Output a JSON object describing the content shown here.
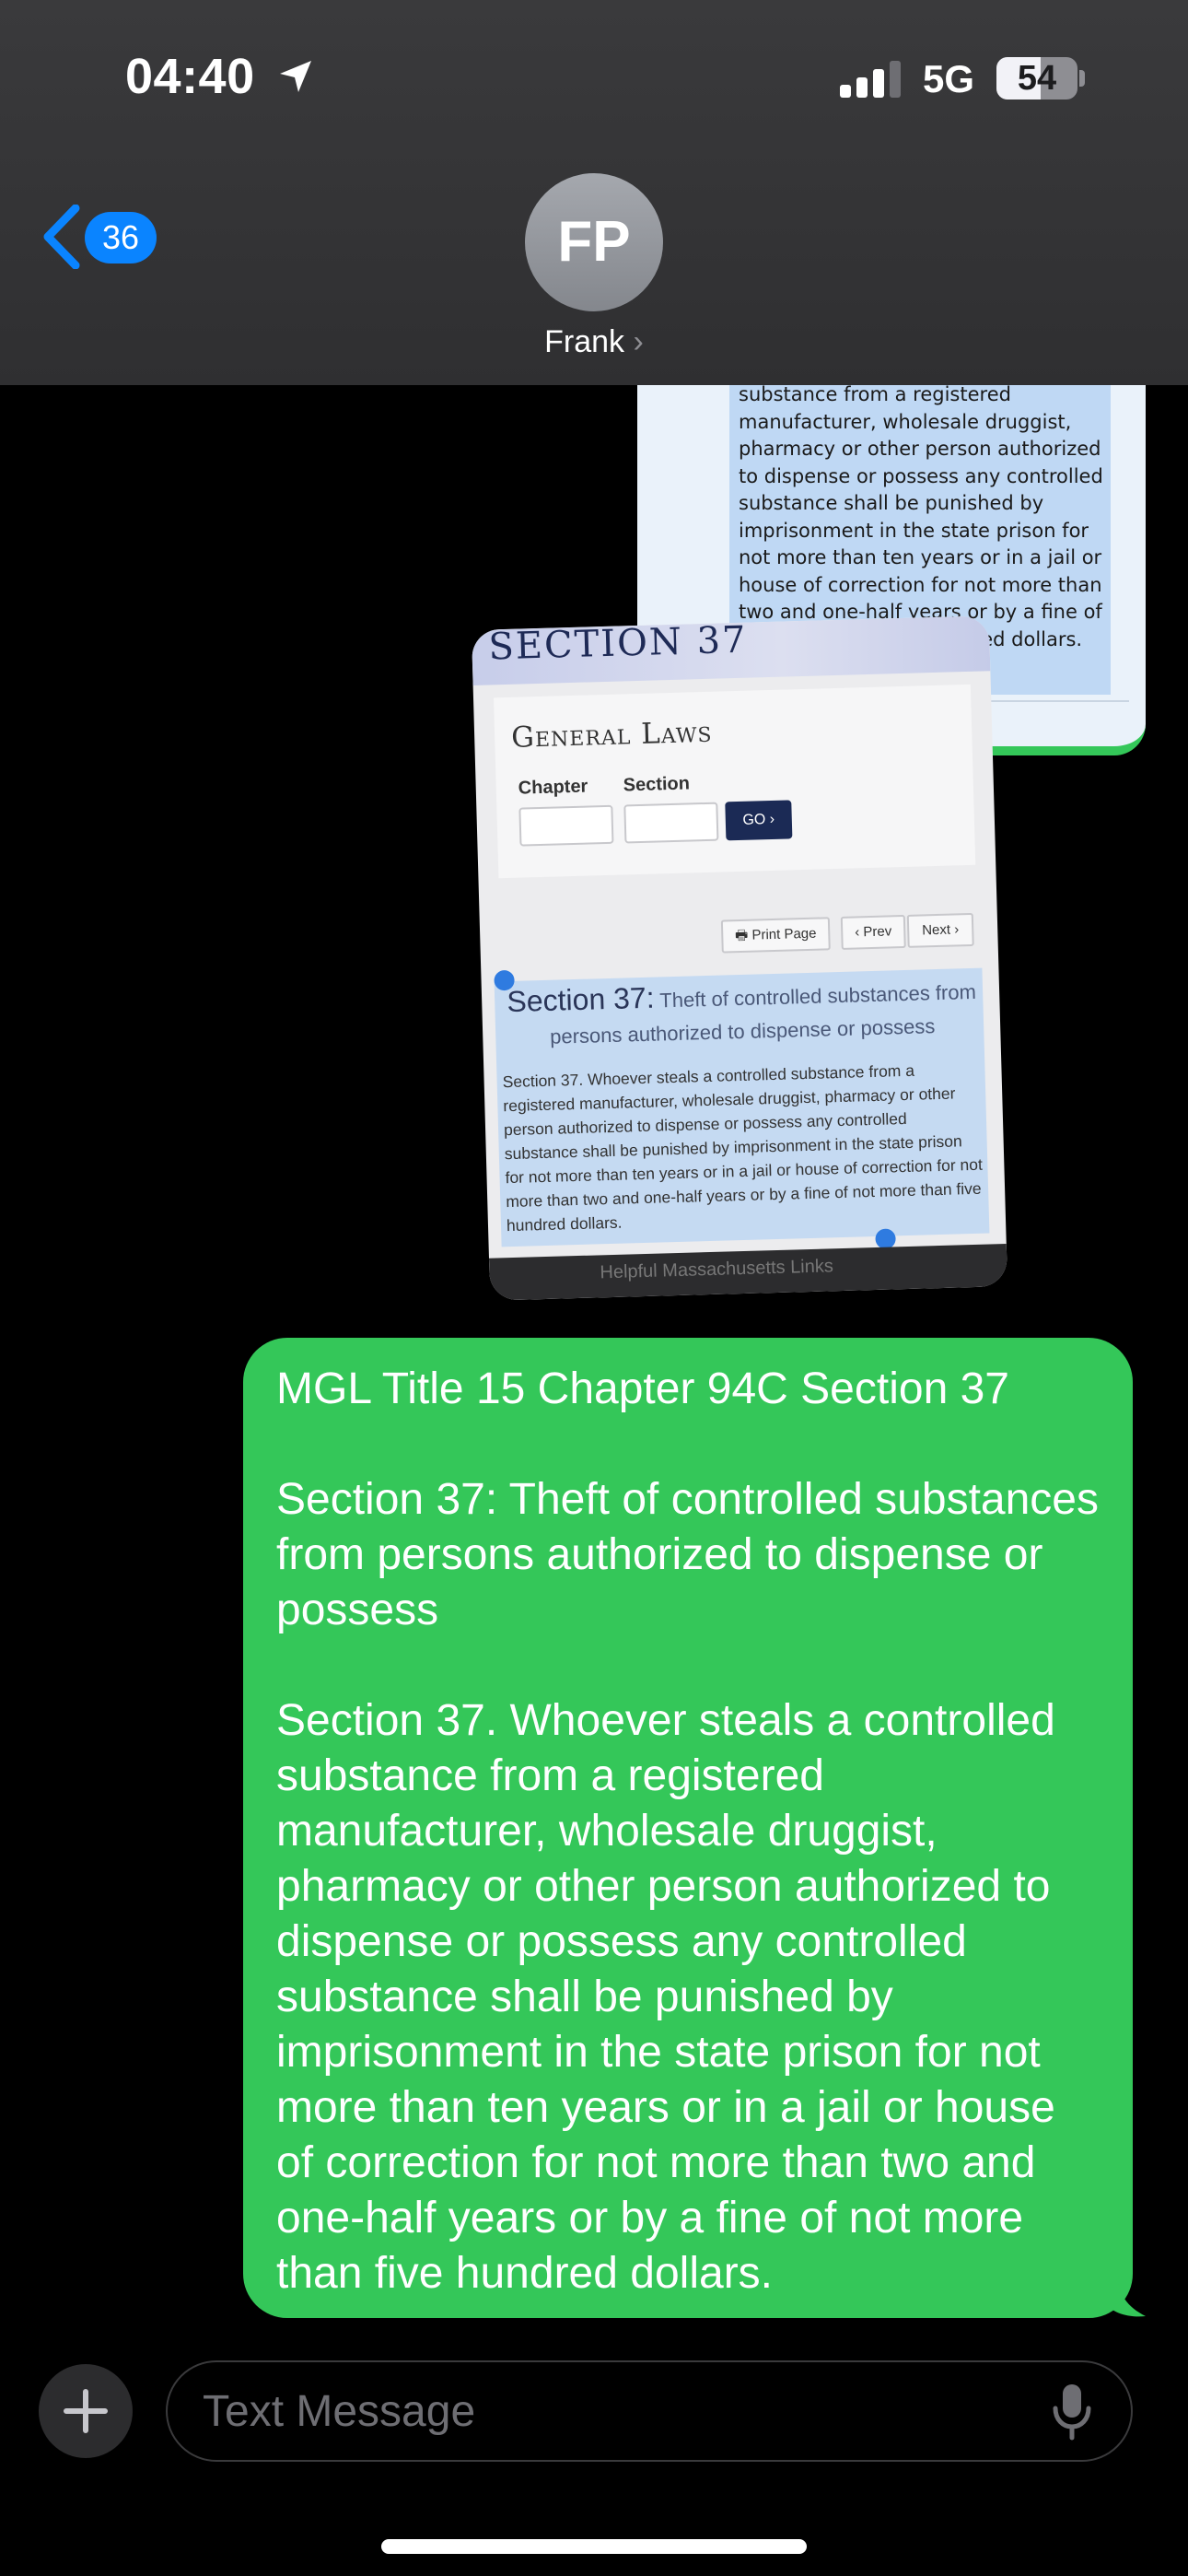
{
  "status_bar": {
    "time": "04:40",
    "network": "5G",
    "battery_level": "54",
    "battery_fraction": 0.54,
    "icons": [
      "location-arrow-icon",
      "cellular-signal-icon",
      "battery-icon"
    ]
  },
  "nav": {
    "back_count": "36",
    "avatar_initials": "FP",
    "contact_name": "Frank",
    "contact_chevron": "›"
  },
  "attachments": {
    "screenshot_top": {
      "text": "substance from a registered manufacturer, wholesale druggist, pharmacy or other person authorized to dispense or possess any controlled substance shall be punished by imprisonment in the state prison for not more than ten years or in a jail or house of correction for not more than two and one-half years or by a fine of not more than five hundred dollars."
    },
    "screenshot_bottom": {
      "banner": "SECTION 37",
      "title": "General Laws",
      "chapter_label": "Chapter",
      "section_label": "Section",
      "go_label": "GO ›",
      "print_label": "🖶 Print Page",
      "prev_label": "‹ Prev",
      "next_label": "Next ›",
      "heading_big": "Section 37:",
      "heading_small": "Theft of controlled substances from persons authorized to dispense or possess",
      "body": "Section 37. Whoever steals a controlled substance from a registered manufacturer, wholesale druggist, pharmacy or other person authorized to dispense or possess any controlled substance shall be punished by imprisonment in the state prison for not more than ten years or in a jail or house of correction for not more than two and one-half years or by a fine of not more than five hundred dollars.",
      "footer": "Helpful Massachusetts Links"
    }
  },
  "message": {
    "line1": "MGL Title 15 Chapter 94C Section 37",
    "line2": "Section 37: Theft of controlled substances from persons authorized to dispense or possess",
    "line3": "Section 37. Whoever steals a controlled substance from a registered manufacturer, wholesale druggist, pharmacy or other person authorized to dispense or possess any controlled substance shall be punished by imprisonment in the state prison for not more than ten years or in a jail or house of correction for not more than two and one-half years or by a fine of not more than five hundred dollars.",
    "bubble_color": "#34c759"
  },
  "composer": {
    "placeholder": "Text Message",
    "accent": "#0a84ff"
  }
}
